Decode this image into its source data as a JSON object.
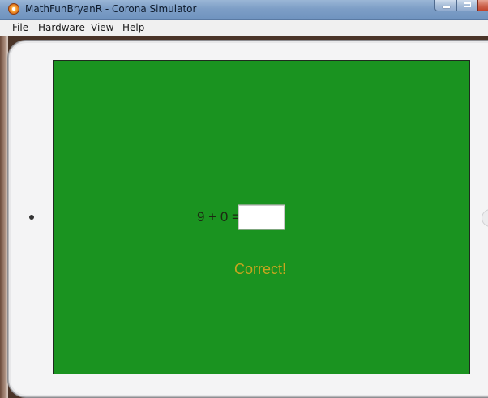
{
  "window": {
    "title": "MathFunBryanR - Corona Simulator",
    "controls": {
      "minimize_icon": "minimize-icon",
      "maximize_icon": "maximize-icon",
      "close_icon": "close-icon"
    }
  },
  "menu": {
    "items": [
      "File",
      "Hardware",
      "View",
      "Help"
    ]
  },
  "device": {
    "type": "tablet",
    "screen_color": "#1a9320"
  },
  "app": {
    "equation": "9 + 0 =",
    "answer_value": "",
    "feedback": "Correct!",
    "feedback_color": "#c9a51e"
  }
}
